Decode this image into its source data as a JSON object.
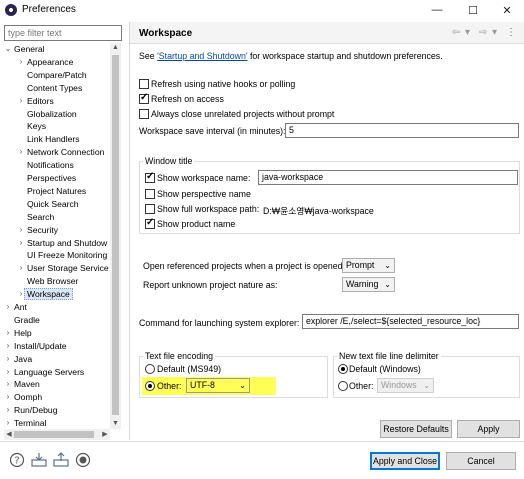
{
  "window": {
    "title": "Preferences",
    "minimize": "—",
    "maximize": "☐",
    "close": "✕"
  },
  "filter": {
    "placeholder": "type filter text"
  },
  "tree": [
    {
      "label": "General",
      "twisty": "⌄",
      "level": 0
    },
    {
      "label": "Appearance",
      "twisty": "›",
      "level": 1
    },
    {
      "label": "Compare/Patch",
      "twisty": "",
      "level": 1
    },
    {
      "label": "Content Types",
      "twisty": "",
      "level": 1
    },
    {
      "label": "Editors",
      "twisty": "›",
      "level": 1
    },
    {
      "label": "Globalization",
      "twisty": "",
      "level": 1
    },
    {
      "label": "Keys",
      "twisty": "",
      "level": 1
    },
    {
      "label": "Link Handlers",
      "twisty": "",
      "level": 1
    },
    {
      "label": "Network Connection",
      "twisty": "›",
      "level": 1
    },
    {
      "label": "Notifications",
      "twisty": "",
      "level": 1
    },
    {
      "label": "Perspectives",
      "twisty": "",
      "level": 1
    },
    {
      "label": "Project Natures",
      "twisty": "",
      "level": 1
    },
    {
      "label": "Quick Search",
      "twisty": "",
      "level": 1
    },
    {
      "label": "Search",
      "twisty": "",
      "level": 1
    },
    {
      "label": "Security",
      "twisty": "›",
      "level": 1
    },
    {
      "label": "Startup and Shutdow",
      "twisty": "›",
      "level": 1
    },
    {
      "label": "UI Freeze Monitoring",
      "twisty": "",
      "level": 1
    },
    {
      "label": "User Storage Service",
      "twisty": "›",
      "level": 1
    },
    {
      "label": "Web Browser",
      "twisty": "",
      "level": 1
    },
    {
      "label": "Workspace",
      "twisty": "›",
      "level": 1,
      "selected": true
    },
    {
      "label": "Ant",
      "twisty": "›",
      "level": 0
    },
    {
      "label": "Gradle",
      "twisty": "",
      "level": 0
    },
    {
      "label": "Help",
      "twisty": "›",
      "level": 0
    },
    {
      "label": "Install/Update",
      "twisty": "›",
      "level": 0
    },
    {
      "label": "Java",
      "twisty": "›",
      "level": 0
    },
    {
      "label": "Language Servers",
      "twisty": "›",
      "level": 0
    },
    {
      "label": "Maven",
      "twisty": "›",
      "level": 0
    },
    {
      "label": "Oomph",
      "twisty": "›",
      "level": 0
    },
    {
      "label": "Run/Debug",
      "twisty": "›",
      "level": 0
    },
    {
      "label": "Terminal",
      "twisty": "›",
      "level": 0
    }
  ],
  "page": {
    "title": "Workspace",
    "see_prefix": "See ",
    "see_link": "'Startup and Shutdown'",
    "see_suffix": " for workspace startup and shutdown preferences.",
    "refresh_native": "Refresh using native hooks or polling",
    "refresh_native_checked": false,
    "refresh_access": "Refresh on access",
    "refresh_access_checked": true,
    "always_close": "Always close unrelated projects without prompt",
    "always_close_checked": false,
    "save_interval_label": "Workspace save interval (in minutes):",
    "save_interval_value": "5",
    "window_title_group": "Window title",
    "show_ws_name": "Show workspace name:",
    "show_ws_name_checked": true,
    "ws_name_value": "java-workspace",
    "show_perspective": "Show perspective name",
    "show_perspective_checked": false,
    "show_full_path": "Show full workspace path:",
    "show_full_path_checked": false,
    "full_path_value": "D:₩윤소영₩java-workspace",
    "show_product": "Show product name",
    "show_product_checked": true,
    "open_ref_label": "Open referenced projects when a project is opened:",
    "open_ref_value": "Prompt",
    "report_unknown_label": "Report unknown project nature as:",
    "report_unknown_value": "Warning",
    "cmd_label": "Command for launching system explorer:",
    "cmd_value": "explorer /E,/select=${selected_resource_loc}",
    "encoding_group": "Text file encoding",
    "enc_default": "Default (MS949)",
    "enc_other": "Other:",
    "enc_other_value": "UTF-8",
    "delim_group": "New text file line delimiter",
    "delim_default": "Default (Windows)",
    "delim_other": "Other:",
    "delim_other_value": "Windows",
    "restore_defaults": "Restore Defaults",
    "apply": "Apply"
  },
  "footer": {
    "apply_close": "Apply and Close",
    "cancel": "Cancel"
  },
  "colors": {
    "highlight": "#ffff55",
    "accent": "#0078d7",
    "link": "#0645ad"
  }
}
